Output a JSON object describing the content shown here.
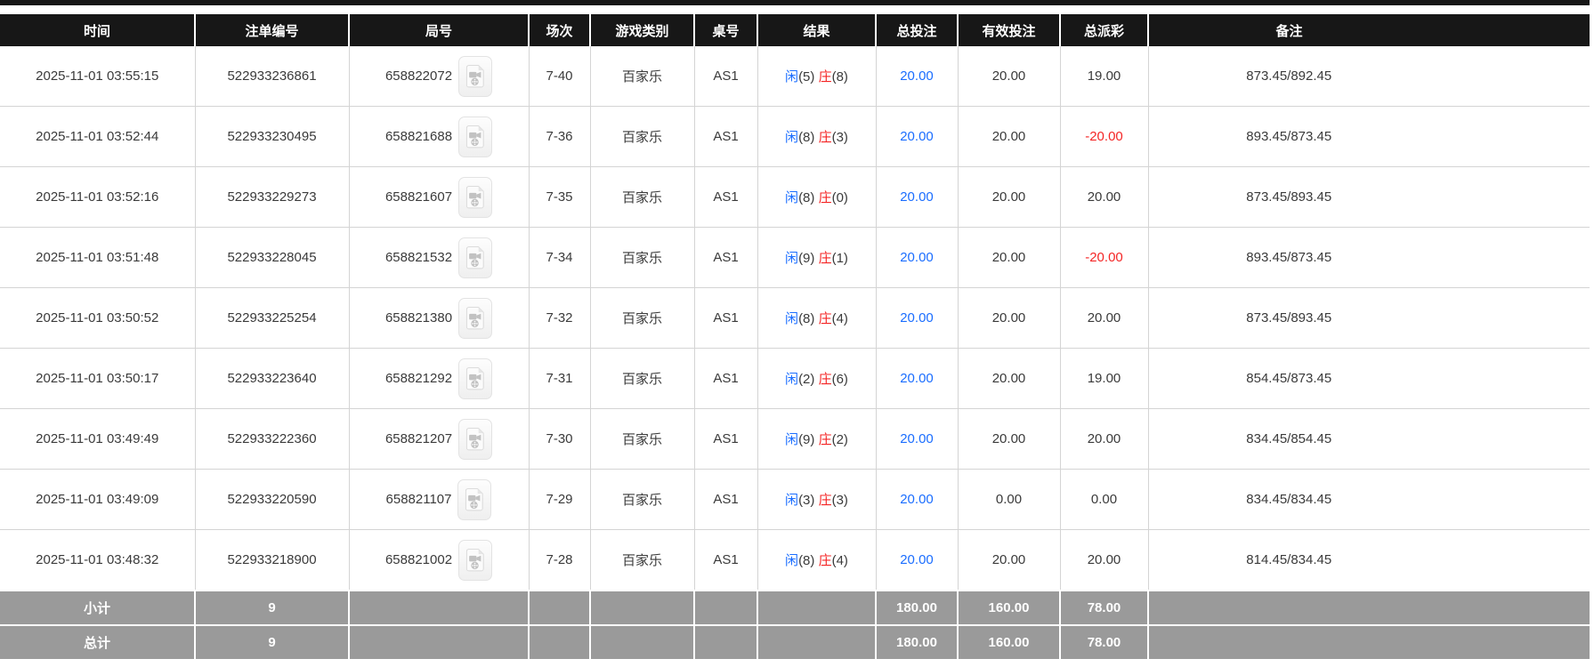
{
  "table": {
    "columns": [
      {
        "key": "time",
        "label": "时间"
      },
      {
        "key": "bet_no",
        "label": "注单编号"
      },
      {
        "key": "round_no",
        "label": "局号"
      },
      {
        "key": "session",
        "label": "场次"
      },
      {
        "key": "game",
        "label": "游戏类别"
      },
      {
        "key": "table_no",
        "label": "桌号"
      },
      {
        "key": "result",
        "label": "结果"
      },
      {
        "key": "total_bet",
        "label": "总投注"
      },
      {
        "key": "valid_bet",
        "label": "有效投注"
      },
      {
        "key": "payout",
        "label": "总派彩"
      },
      {
        "key": "remark",
        "label": "备注"
      }
    ],
    "rows": [
      {
        "time": "2025-11-01 03:55:15",
        "bet_no": "522933236861",
        "round_no": "658822072",
        "session": "7-40",
        "game": "百家乐",
        "table_no": "AS1",
        "player_label": "闲",
        "player_pts": "(5)",
        "banker_label": "庄",
        "banker_pts": "(8)",
        "total_bet": "20.00",
        "valid_bet": "20.00",
        "payout": "19.00",
        "remark": "873.45/892.45"
      },
      {
        "time": "2025-11-01 03:52:44",
        "bet_no": "522933230495",
        "round_no": "658821688",
        "session": "7-36",
        "game": "百家乐",
        "table_no": "AS1",
        "player_label": "闲",
        "player_pts": "(8)",
        "banker_label": "庄",
        "banker_pts": "(3)",
        "total_bet": "20.00",
        "valid_bet": "20.00",
        "payout": "-20.00",
        "remark": "893.45/873.45"
      },
      {
        "time": "2025-11-01 03:52:16",
        "bet_no": "522933229273",
        "round_no": "658821607",
        "session": "7-35",
        "game": "百家乐",
        "table_no": "AS1",
        "player_label": "闲",
        "player_pts": "(8)",
        "banker_label": "庄",
        "banker_pts": "(0)",
        "total_bet": "20.00",
        "valid_bet": "20.00",
        "payout": "20.00",
        "remark": "873.45/893.45"
      },
      {
        "time": "2025-11-01 03:51:48",
        "bet_no": "522933228045",
        "round_no": "658821532",
        "session": "7-34",
        "game": "百家乐",
        "table_no": "AS1",
        "player_label": "闲",
        "player_pts": "(9)",
        "banker_label": "庄",
        "banker_pts": "(1)",
        "total_bet": "20.00",
        "valid_bet": "20.00",
        "payout": "-20.00",
        "remark": "893.45/873.45"
      },
      {
        "time": "2025-11-01 03:50:52",
        "bet_no": "522933225254",
        "round_no": "658821380",
        "session": "7-32",
        "game": "百家乐",
        "table_no": "AS1",
        "player_label": "闲",
        "player_pts": "(8)",
        "banker_label": "庄",
        "banker_pts": "(4)",
        "total_bet": "20.00",
        "valid_bet": "20.00",
        "payout": "20.00",
        "remark": "873.45/893.45"
      },
      {
        "time": "2025-11-01 03:50:17",
        "bet_no": "522933223640",
        "round_no": "658821292",
        "session": "7-31",
        "game": "百家乐",
        "table_no": "AS1",
        "player_label": "闲",
        "player_pts": "(2)",
        "banker_label": "庄",
        "banker_pts": "(6)",
        "total_bet": "20.00",
        "valid_bet": "20.00",
        "payout": "19.00",
        "remark": "854.45/873.45"
      },
      {
        "time": "2025-11-01 03:49:49",
        "bet_no": "522933222360",
        "round_no": "658821207",
        "session": "7-30",
        "game": "百家乐",
        "table_no": "AS1",
        "player_label": "闲",
        "player_pts": "(9)",
        "banker_label": "庄",
        "banker_pts": "(2)",
        "total_bet": "20.00",
        "valid_bet": "20.00",
        "payout": "20.00",
        "remark": "834.45/854.45"
      },
      {
        "time": "2025-11-01 03:49:09",
        "bet_no": "522933220590",
        "round_no": "658821107",
        "session": "7-29",
        "game": "百家乐",
        "table_no": "AS1",
        "player_label": "闲",
        "player_pts": "(3)",
        "banker_label": "庄",
        "banker_pts": "(3)",
        "total_bet": "20.00",
        "valid_bet": "0.00",
        "payout": "0.00",
        "remark": "834.45/834.45"
      },
      {
        "time": "2025-11-01 03:48:32",
        "bet_no": "522933218900",
        "round_no": "658821002",
        "session": "7-28",
        "game": "百家乐",
        "table_no": "AS1",
        "player_label": "闲",
        "player_pts": "(8)",
        "banker_label": "庄",
        "banker_pts": "(4)",
        "total_bet": "20.00",
        "valid_bet": "20.00",
        "payout": "20.00",
        "remark": "814.45/834.45"
      }
    ],
    "footer": [
      {
        "label": "小计",
        "count": "9",
        "total_bet": "180.00",
        "valid_bet": "160.00",
        "payout": "78.00",
        "remark": ""
      },
      {
        "label": "总计",
        "count": "9",
        "total_bet": "180.00",
        "valid_bet": "160.00",
        "payout": "78.00",
        "remark": ""
      }
    ]
  },
  "icons": {
    "video_replay": "video-replay-icon"
  },
  "colors": {
    "header_bg": "#171717",
    "footer_bg": "#9a9a9a",
    "player_blue": "#1a6dff",
    "banker_red": "#f42525",
    "negative_red": "#f42525",
    "total_bet_blue": "#1a6dff"
  }
}
